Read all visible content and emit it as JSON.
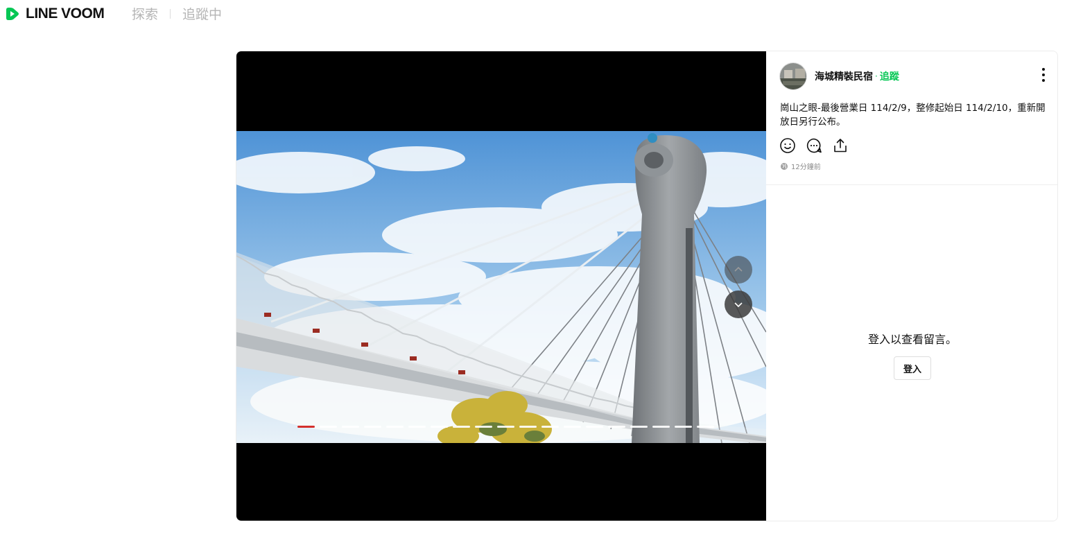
{
  "header": {
    "brand": "LINE VOOM",
    "tabs": [
      {
        "label": "探索",
        "active": false
      },
      {
        "label": "追蹤中",
        "active": false
      }
    ]
  },
  "post": {
    "author": "海城精裝民宿",
    "follow_label": "追蹤",
    "text": "崗山之眼-最後營業日 114/2/9，整修起始日 114/2/10，重新開放日另行公布。",
    "time": "12分鐘前",
    "visibility_icon": "globe-icon",
    "actions": [
      "smile-icon",
      "comment-icon",
      "share-icon"
    ],
    "media": {
      "slide_count": 19,
      "active_slide": 1
    }
  },
  "comments": {
    "login_message": "登入以查看留言。",
    "login_button": "登入"
  },
  "colors": {
    "brand_green": "#06c755",
    "progress_active": "#d4302c",
    "media_bg": "#000000"
  }
}
